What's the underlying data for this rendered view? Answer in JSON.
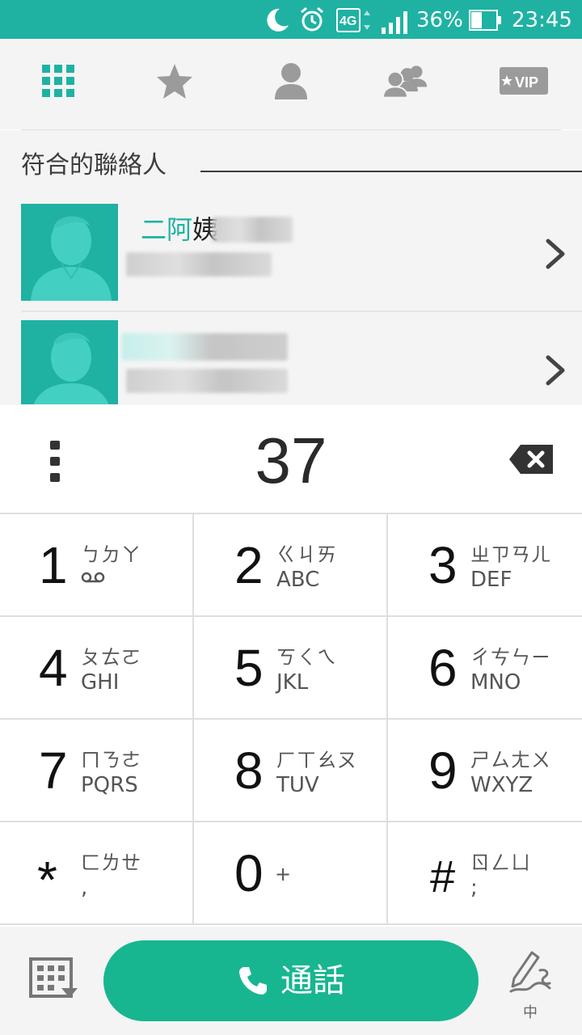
{
  "status_bar": {
    "network": "4G",
    "battery_percent": "36%",
    "time": "23:45",
    "icons": [
      "moon-icon",
      "alarm-icon",
      "4g-icon",
      "signal-icon",
      "battery-icon"
    ]
  },
  "tabs": [
    {
      "name": "dialpad",
      "icon": "grid-icon",
      "active": true
    },
    {
      "name": "favorites",
      "icon": "star-icon",
      "active": false
    },
    {
      "name": "contacts",
      "icon": "person-icon",
      "active": false
    },
    {
      "name": "groups",
      "icon": "group-icon",
      "active": false
    },
    {
      "name": "vip",
      "icon": "vip-icon",
      "label": "VIP",
      "active": false
    }
  ],
  "matching_contacts": {
    "title": "符合的聯絡人",
    "items": [
      {
        "name_highlight": "二阿",
        "name_rest": "姨"
      },
      {
        "name_highlight": "",
        "name_rest": ""
      }
    ]
  },
  "dialer": {
    "number": "37"
  },
  "keypad": [
    {
      "digit": "1",
      "zhuyin": "ㄅㄉㄚ",
      "letters": "",
      "voicemail": true
    },
    {
      "digit": "2",
      "zhuyin": "ㄍㄐㄞ",
      "letters": "ABC"
    },
    {
      "digit": "3",
      "zhuyin": "ㄓㄗㄢㄦ",
      "letters": "DEF"
    },
    {
      "digit": "4",
      "zhuyin": "ㄆㄊㄛ",
      "letters": "GHI"
    },
    {
      "digit": "5",
      "zhuyin": "ㄎㄑㄟ",
      "letters": "JKL"
    },
    {
      "digit": "6",
      "zhuyin": "ㄔㄘㄣㄧ",
      "letters": "MNO"
    },
    {
      "digit": "7",
      "zhuyin": "ㄇㄋㄜ",
      "letters": "PQRS"
    },
    {
      "digit": "8",
      "zhuyin": "ㄏㄒㄠㄡ",
      "letters": "TUV"
    },
    {
      "digit": "9",
      "zhuyin": "ㄕㄙㄤㄨ",
      "letters": "WXYZ"
    },
    {
      "digit": "*",
      "zhuyin": "ㄈㄌㄝ",
      "letters": ","
    },
    {
      "digit": "0",
      "zhuyin": "+",
      "letters": ""
    },
    {
      "digit": "#",
      "zhuyin": "ㄖㄥㄩ",
      "letters": ";"
    }
  ],
  "bottom_bar": {
    "call_label": "通話",
    "handwrite_label": "中"
  },
  "colors": {
    "accent": "#1fb2a3",
    "call_green": "#17b690",
    "icon_grey": "#9b9b9b"
  }
}
